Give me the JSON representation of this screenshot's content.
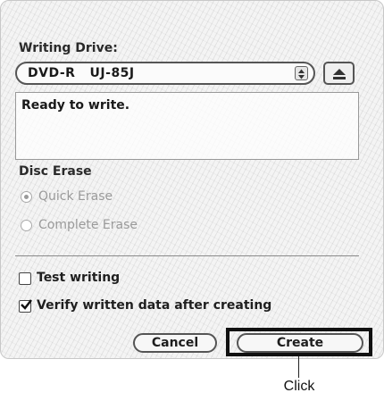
{
  "dialog": {
    "writing_drive_label": "Writing Drive:",
    "drive": {
      "selected": "DVD-R   UJ-85J"
    },
    "status": "Ready to write.",
    "disc_erase": {
      "label": "Disc Erase",
      "options": [
        {
          "label": "Quick Erase",
          "selected": true,
          "enabled": false
        },
        {
          "label": "Complete Erase",
          "selected": false,
          "enabled": false
        }
      ]
    },
    "test_writing": {
      "label": "Test writing",
      "checked": false
    },
    "verify": {
      "label": "Verify written data after creating",
      "checked": true
    },
    "buttons": {
      "cancel": "Cancel",
      "create": "Create"
    }
  },
  "callout": {
    "text": "Click"
  },
  "icons": {
    "popup_arrows": "up-down-arrows-icon",
    "eject": "eject-icon",
    "checkmark": "checkmark-icon"
  }
}
